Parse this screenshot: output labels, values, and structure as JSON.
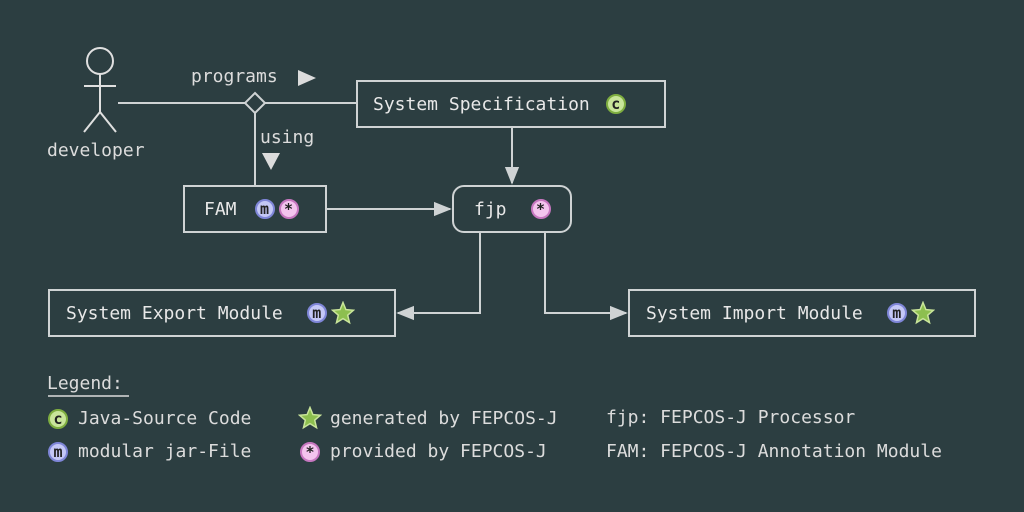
{
  "actor": {
    "label": "developer"
  },
  "edges": {
    "programs": "programs",
    "using": "using"
  },
  "nodes": {
    "spec": {
      "label": "System Specification",
      "badge": "c"
    },
    "fam": {
      "label": "FAM",
      "badges": [
        "m",
        "*"
      ]
    },
    "fjp": {
      "label": "fjp",
      "badge": "*"
    },
    "export": {
      "label": "System Export Module",
      "badge": "m"
    },
    "import": {
      "label": "System Import Module",
      "badge": "m"
    }
  },
  "legend": {
    "title": "Legend:",
    "c_text": "Java-Source Code",
    "m_text": "modular jar-File",
    "star_text": "generated by FEPCOS-J",
    "asterisk_text": "provided by FEPCOS-J",
    "fjp_text": "fjp: FEPCOS-J Processor",
    "fam_text": "FAM: FEPCOS-J Annotation Module"
  },
  "colors": {
    "background": "#2c3e41",
    "line": "#cfd3d4",
    "badge_c": "#c9e59a",
    "badge_m": "#c4c8f6",
    "badge_s": "#f4c4ee",
    "star": "#8dbf4f"
  }
}
